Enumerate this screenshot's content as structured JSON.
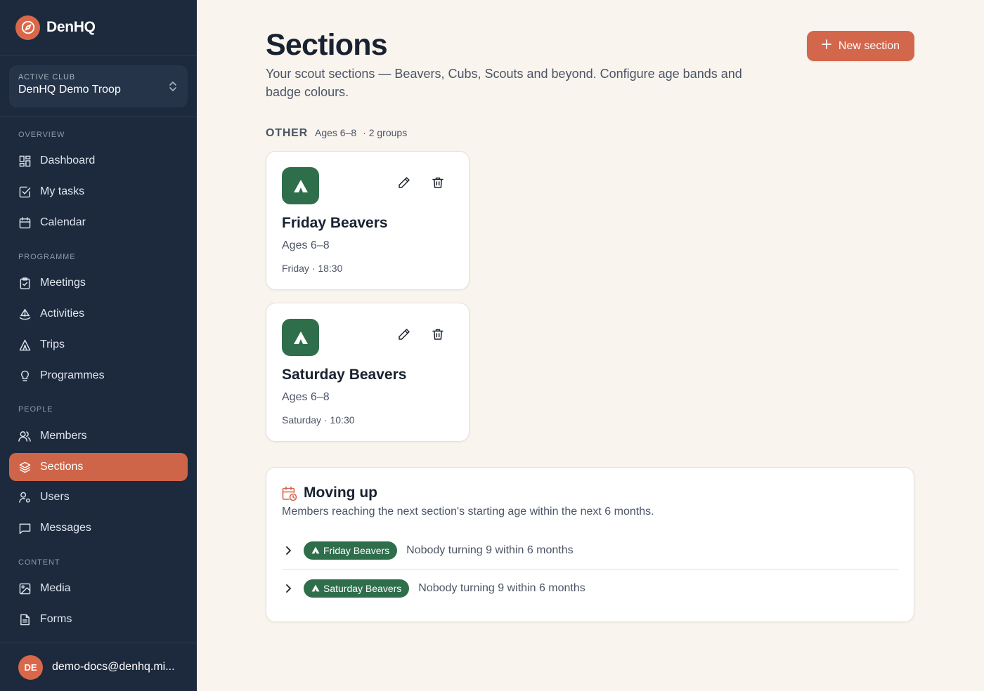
{
  "brand": {
    "name": "DenHQ"
  },
  "club": {
    "label": "ACTIVE CLUB",
    "name": "DenHQ Demo Troop"
  },
  "nav": {
    "overview": "OVERVIEW",
    "programme": "PROGRAMME",
    "people": "PEOPLE",
    "content": "CONTENT",
    "items": {
      "dashboard": "Dashboard",
      "tasks": "My tasks",
      "calendar": "Calendar",
      "meetings": "Meetings",
      "activities": "Activities",
      "trips": "Trips",
      "programmes": "Programmes",
      "members": "Members",
      "sections": "Sections",
      "users": "Users",
      "messages": "Messages",
      "media": "Media",
      "forms": "Forms"
    }
  },
  "user": {
    "initials": "DE",
    "email": "demo-docs@denhq.mi..."
  },
  "page": {
    "title": "Sections",
    "subtitle": "Your scout sections — Beavers, Cubs, Scouts and beyond. Configure age bands and badge colours.",
    "new_button": "New section"
  },
  "group": {
    "name": "OTHER",
    "ages": "Ages 6–8",
    "count": "· 2 groups"
  },
  "sections": [
    {
      "title": "Friday Beavers",
      "age": "Ages 6–8",
      "when": "Friday · 18:30"
    },
    {
      "title": "Saturday Beavers",
      "age": "Ages 6–8",
      "when": "Saturday · 10:30"
    }
  ],
  "moving_up": {
    "title": "Moving up",
    "description": "Members reaching the next section's starting age within the next 6 months.",
    "rows": [
      {
        "section": "Friday Beavers",
        "text": "Nobody turning 9 within 6 months"
      },
      {
        "section": "Saturday Beavers",
        "text": "Nobody turning 9 within 6 months"
      }
    ]
  },
  "colors": {
    "accent": "#d3674b",
    "sidebar": "#1d2a3d",
    "badge_green": "#2f6e4b"
  }
}
